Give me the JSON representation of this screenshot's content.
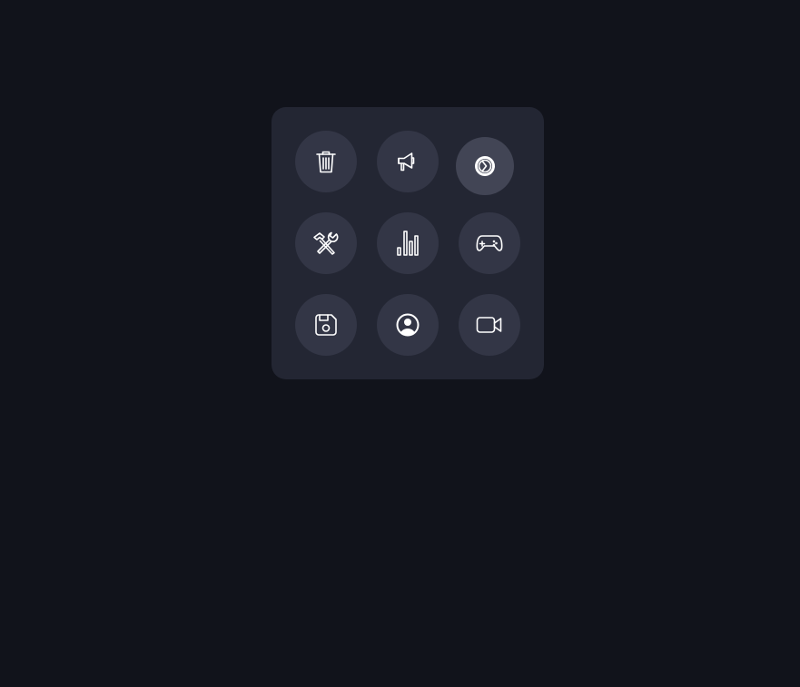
{
  "panel": {
    "buttons": [
      {
        "id": "trash",
        "icon": "trash-icon"
      },
      {
        "id": "megaphone",
        "icon": "megaphone-icon"
      },
      {
        "id": "gear",
        "icon": "gear-icon",
        "state": "active"
      },
      {
        "id": "tools",
        "icon": "hammer-wrench-icon"
      },
      {
        "id": "stats",
        "icon": "bar-chart-icon"
      },
      {
        "id": "gamepad",
        "icon": "gamepad-icon"
      },
      {
        "id": "save",
        "icon": "floppy-disk-icon"
      },
      {
        "id": "account",
        "icon": "user-circle-icon"
      },
      {
        "id": "video",
        "icon": "video-camera-icon"
      }
    ]
  },
  "colors": {
    "background": "#11131b",
    "panel": "#232633",
    "button": "#333646",
    "button_active": "#424555",
    "icon": "#ffffff"
  }
}
